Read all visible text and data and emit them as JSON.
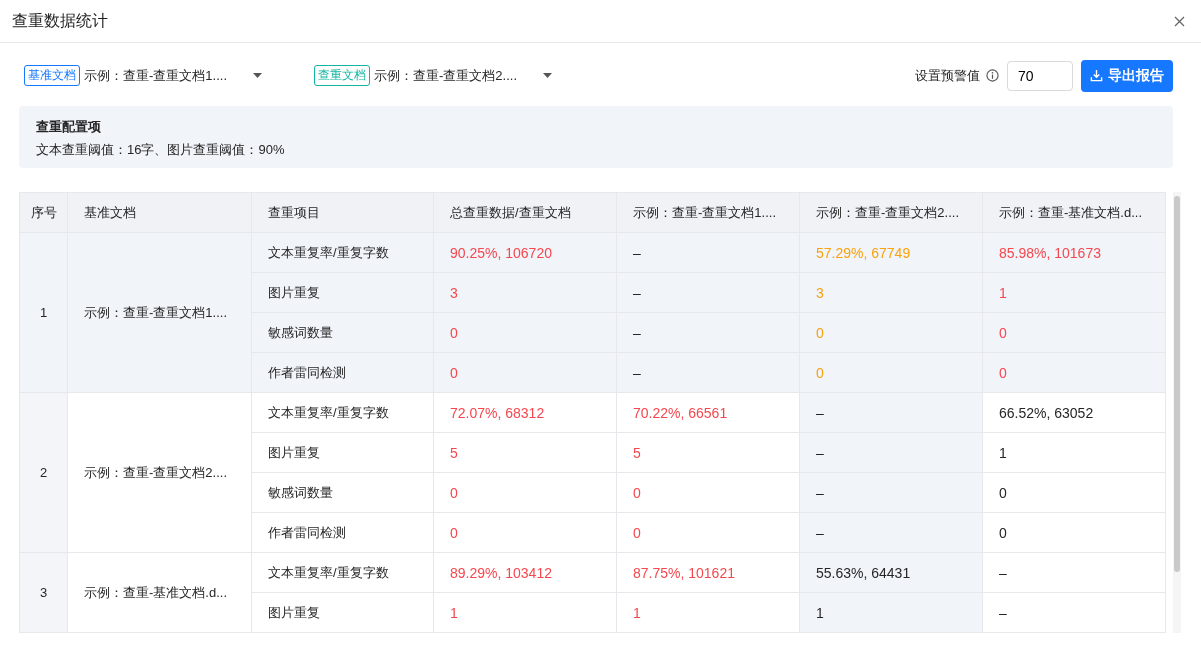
{
  "title": "查重数据统计",
  "baseline": {
    "tag": "基准文档",
    "value": "示例：查重-查重文档1...."
  },
  "compare": {
    "tag": "查重文档",
    "value": "示例：查重-查重文档2...."
  },
  "warning": {
    "label": "设置预警值",
    "value": "70"
  },
  "export_button": "导出报告",
  "config": {
    "title": "查重配置项",
    "text": "文本查重阈值：16字、图片查重阈值：90%"
  },
  "table": {
    "columns": [
      "序号",
      "基准文档",
      "查重项目",
      "总查重数据/查重文档",
      "示例：查重-查重文档1....",
      "示例：查重-查重文档2....",
      "示例：查重-基准文档.d..."
    ],
    "groups": [
      {
        "index": "1",
        "document": "示例：查重-查重文档1....",
        "highlighted": true,
        "items": [
          {
            "item": "文本重复率/重复字数",
            "cells": [
              {
                "text": "90.25%, 106720",
                "color": "#f5474e",
                "highlighted": true
              },
              {
                "text": "–",
                "highlighted": true
              },
              {
                "text": "57.29%, 67749",
                "color": "#f9a20c",
                "highlighted": true
              },
              {
                "text": "85.98%, 101673",
                "color": "#f5474e",
                "highlighted": true
              }
            ]
          },
          {
            "item": "图片重复",
            "cells": [
              {
                "text": "3",
                "color": "#f5474e",
                "highlighted": true
              },
              {
                "text": "–",
                "highlighted": true
              },
              {
                "text": "3",
                "color": "#f9a20c",
                "highlighted": true
              },
              {
                "text": "1",
                "color": "#f5474e",
                "highlighted": true
              }
            ]
          },
          {
            "item": "敏感词数量",
            "cells": [
              {
                "text": "0",
                "color": "#f5474e",
                "highlighted": true
              },
              {
                "text": "–",
                "highlighted": true
              },
              {
                "text": "0",
                "color": "#f9a20c",
                "highlighted": true
              },
              {
                "text": "0",
                "color": "#f5474e",
                "highlighted": true
              }
            ]
          },
          {
            "item": "作者雷同检测",
            "cells": [
              {
                "text": "0",
                "color": "#f5474e",
                "highlighted": true
              },
              {
                "text": "–",
                "highlighted": true
              },
              {
                "text": "0",
                "color": "#f9a20c",
                "highlighted": true
              },
              {
                "text": "0",
                "color": "#f5474e",
                "highlighted": true
              }
            ]
          }
        ]
      },
      {
        "index": "2",
        "document": "示例：查重-查重文档2....",
        "highlighted": false,
        "items": [
          {
            "item": "文本重复率/重复字数",
            "cells": [
              {
                "text": "72.07%, 68312",
                "color": "#f5474e",
                "highlighted": false
              },
              {
                "text": "70.22%, 66561",
                "color": "#f5474e",
                "highlighted": false
              },
              {
                "text": "–",
                "highlighted": true
              },
              {
                "text": "66.52%, 63052",
                "highlighted": false
              }
            ]
          },
          {
            "item": "图片重复",
            "cells": [
              {
                "text": "5",
                "color": "#f5474e",
                "highlighted": false
              },
              {
                "text": "5",
                "color": "#f5474e",
                "highlighted": false
              },
              {
                "text": "–",
                "highlighted": true
              },
              {
                "text": "1",
                "highlighted": false
              }
            ]
          },
          {
            "item": "敏感词数量",
            "cells": [
              {
                "text": "0",
                "color": "#f5474e",
                "highlighted": false
              },
              {
                "text": "0",
                "color": "#f5474e",
                "highlighted": false
              },
              {
                "text": "–",
                "highlighted": true
              },
              {
                "text": "0",
                "highlighted": false
              }
            ]
          },
          {
            "item": "作者雷同检测",
            "cells": [
              {
                "text": "0",
                "color": "#f5474e",
                "highlighted": false
              },
              {
                "text": "0",
                "color": "#f5474e",
                "highlighted": false
              },
              {
                "text": "–",
                "highlighted": true
              },
              {
                "text": "0",
                "highlighted": false
              }
            ]
          }
        ]
      },
      {
        "index": "3",
        "document": "示例：查重-基准文档.d...",
        "highlighted": false,
        "items": [
          {
            "item": "文本重复率/重复字数",
            "cells": [
              {
                "text": "89.29%, 103412",
                "color": "#f5474e",
                "highlighted": false
              },
              {
                "text": "87.75%, 101621",
                "color": "#f5474e",
                "highlighted": false
              },
              {
                "text": "55.63%, 64431",
                "highlighted": true
              },
              {
                "text": "–",
                "highlighted": false
              }
            ]
          },
          {
            "item": "图片重复",
            "cells": [
              {
                "text": "1",
                "color": "#f5474e",
                "highlighted": false
              },
              {
                "text": "1",
                "color": "#f5474e",
                "highlighted": false
              },
              {
                "text": "1",
                "highlighted": true
              },
              {
                "text": "–",
                "highlighted": false
              }
            ]
          }
        ]
      }
    ]
  }
}
